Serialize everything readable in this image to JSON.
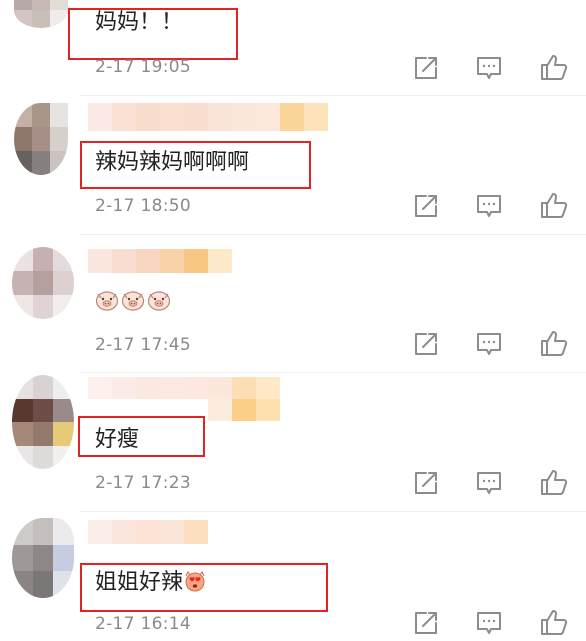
{
  "colors": {
    "highlight_box": "#e02424",
    "timestamp": "#8a8a8a",
    "text": "#222222",
    "icon": "#8c8c8c"
  },
  "actions": {
    "share_icon": "share-icon",
    "reply_icon": "comment-icon",
    "like_icon": "thumbs-up-icon"
  },
  "comments": [
    {
      "text": "妈妈！！",
      "time": "2-17 19:05",
      "highlighted": true
    },
    {
      "text": "辣妈辣妈啊啊啊",
      "time": "2-17 18:50",
      "highlighted": true
    },
    {
      "text": "",
      "emoji": "pig-face-emoji x3",
      "time": "2-17 17:45",
      "highlighted": false
    },
    {
      "text": "好瘦",
      "time": "2-17 17:23",
      "highlighted": true
    },
    {
      "text": "姐姐好辣",
      "emoji": "heart-eyes-emoji",
      "time": "2-17 16:14",
      "highlighted": true
    }
  ]
}
